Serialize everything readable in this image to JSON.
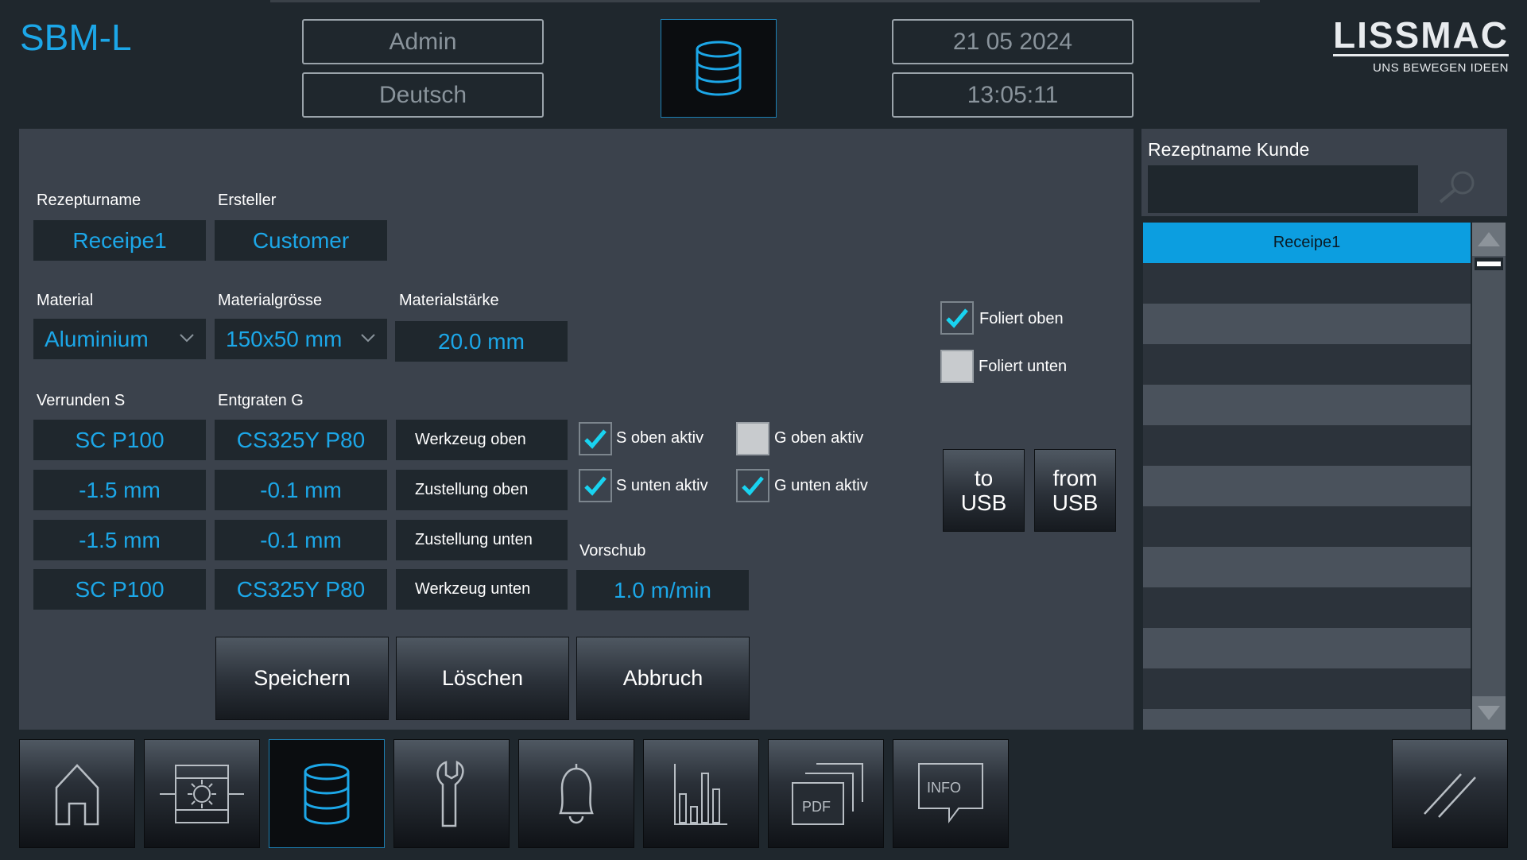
{
  "header": {
    "app_title": "SBM-L",
    "user": "Admin",
    "language": "Deutsch",
    "date": "21 05 2024",
    "time": "13:05:11",
    "logo_text": "LISSMAC",
    "logo_slogan": "UNS BEWEGEN IDEEN"
  },
  "recipe": {
    "name_label": "Rezepturname",
    "name_value": "Receipe1",
    "creator_label": "Ersteller",
    "creator_value": "Customer",
    "material_label": "Material",
    "material_value": "Aluminium",
    "size_label": "Materialgrösse",
    "size_value": "150x50 mm",
    "thickness_label": "Materialstärke",
    "thickness_value": "20.0 mm",
    "verrunden_label": "Verrunden S",
    "entgraten_label": "Entgraten G",
    "rows": [
      {
        "s": "SC P100",
        "g": "CS325Y P80",
        "label": "Werkzeug oben"
      },
      {
        "s": "-1.5 mm",
        "g": "-0.1 mm",
        "label": "Zustellung oben"
      },
      {
        "s": "-1.5 mm",
        "g": "-0.1 mm",
        "label": "Zustellung unten"
      },
      {
        "s": "SC P100",
        "g": "CS325Y P80",
        "label": "Werkzeug unten"
      }
    ],
    "vorschub_label": "Vorschub",
    "vorschub_value": "1.0 m/min",
    "checks": {
      "s_oben": {
        "label": "S oben aktiv",
        "checked": true
      },
      "s_unten": {
        "label": "S unten aktiv",
        "checked": true
      },
      "g_oben": {
        "label": "G oben aktiv",
        "checked": false
      },
      "g_unten": {
        "label": "G unten aktiv",
        "checked": true
      },
      "foliert_oben": {
        "label": "Foliert oben",
        "checked": true
      },
      "foliert_unten": {
        "label": "Foliert unten",
        "checked": false
      }
    },
    "buttons": {
      "save": "Speichern",
      "delete": "Löschen",
      "cancel": "Abbruch",
      "to_usb_1": "to",
      "to_usb_2": "USB",
      "from_usb_1": "from",
      "from_usb_2": "USB"
    }
  },
  "sidebar": {
    "search_label": "Rezeptname Kunde",
    "search_value": "",
    "items": [
      "Receipe1"
    ]
  },
  "nav": {
    "items": [
      "home-icon",
      "machine-settings-icon",
      "database-icon",
      "wrench-icon",
      "bell-icon",
      "bar-chart-icon",
      "pdf-icon",
      "info-icon"
    ],
    "info_text": "INFO",
    "pdf_text": "PDF",
    "active": "database-icon"
  },
  "colors": {
    "accent": "#1ca7e8",
    "selected_row": "#0c9ee0",
    "check": "#19d3f0"
  }
}
